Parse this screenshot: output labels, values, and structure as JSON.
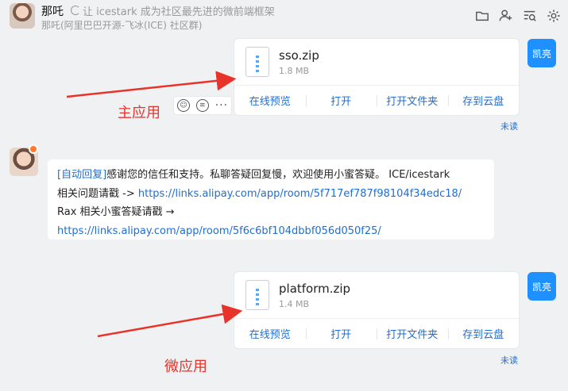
{
  "header": {
    "name": "那吒",
    "status": "让 icestark 成为社区最先进的微前端框架",
    "subtitle": "那吒(阿里巴巴开源-飞冰(ICE) 社区群)",
    "icons": [
      "folder-icon",
      "add-user-icon",
      "search-history-icon",
      "gear-icon"
    ]
  },
  "messages": [
    {
      "file_name": "sso.zip",
      "file_size": "1.8 MB",
      "actions": [
        "在线预览",
        "打开",
        "打开文件夹",
        "存到云盘"
      ],
      "sender": "凯亮",
      "read_status": "未读",
      "annotation": "主应用"
    },
    {
      "file_name": "platform.zip",
      "file_size": "1.4 MB",
      "actions": [
        "在线预览",
        "打开",
        "打开文件夹",
        "存到云盘"
      ],
      "sender": "凯亮",
      "read_status": "未读",
      "annotation": "微应用"
    }
  ],
  "bot_reply": {
    "tag": "[自动回复]",
    "text1": "感谢您的信任和支持。私聊答疑回复慢，欢迎使用小蜜答疑。 ICE/icestark",
    "text2": "相关问题请戳 -> ",
    "link1": "https://links.alipay.com/app/room/5f717ef787f98104f34edc18/",
    "text3": "Rax 相关小蜜答疑请戳 →",
    "link2": "https://links.alipay.com/app/room/5f6c6bf104dbbf056d050f25/"
  },
  "colors": {
    "accent": "#1e90ff",
    "link": "#1f6ed4",
    "annotation": "#e8332b"
  }
}
